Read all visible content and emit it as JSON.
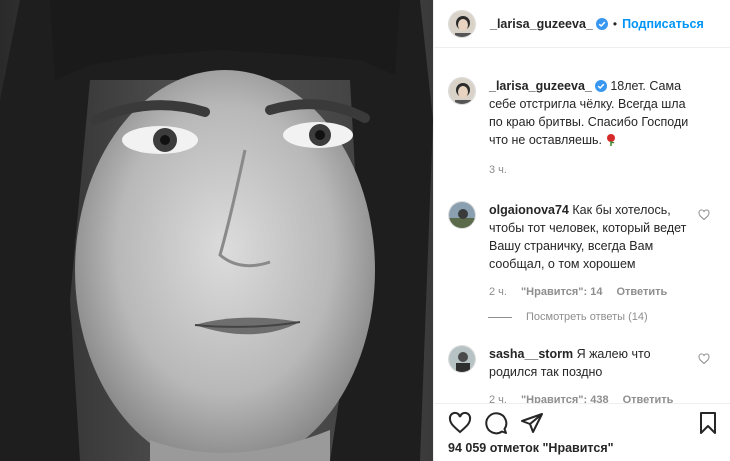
{
  "post": {
    "username": "_larisa_guzeeva_",
    "dot": "•",
    "follow_label": "Подписаться",
    "caption": "18лет. Сама себе отстригла чёлку. Всегда шла по краю бритвы. Спасибо Господи что не оставляешь.",
    "caption_emoji": "rose-emoji",
    "caption_time": "3 ч.",
    "likes_label": "94 059 отметок \"Нравится\""
  },
  "comments": [
    {
      "username": "olgaionova74",
      "text": "Как бы хотелось, чтобы тот человек, который ведет Вашу страничку, всегда Вам сообщал, о том хорошем",
      "time": "2 ч.",
      "likes": "\"Нравится\": 14",
      "reply": "Ответить",
      "view_replies": "Посмотреть ответы (14)"
    },
    {
      "username": "sasha__storm",
      "text": "Я жалею что родился так поздно",
      "time": "2 ч.",
      "likes": "\"Нравится\": 438",
      "reply": "Ответить"
    }
  ],
  "icons": {
    "verified": "verified-badge-icon",
    "like": "heart-icon",
    "comment": "comment-bubble-icon",
    "share": "paper-plane-icon",
    "save": "bookmark-icon"
  },
  "colors": {
    "link_blue": "#0095f6",
    "verified_blue": "#3897f0",
    "meta_gray": "#8e8e8e",
    "text": "#262626",
    "border": "#efefef"
  }
}
